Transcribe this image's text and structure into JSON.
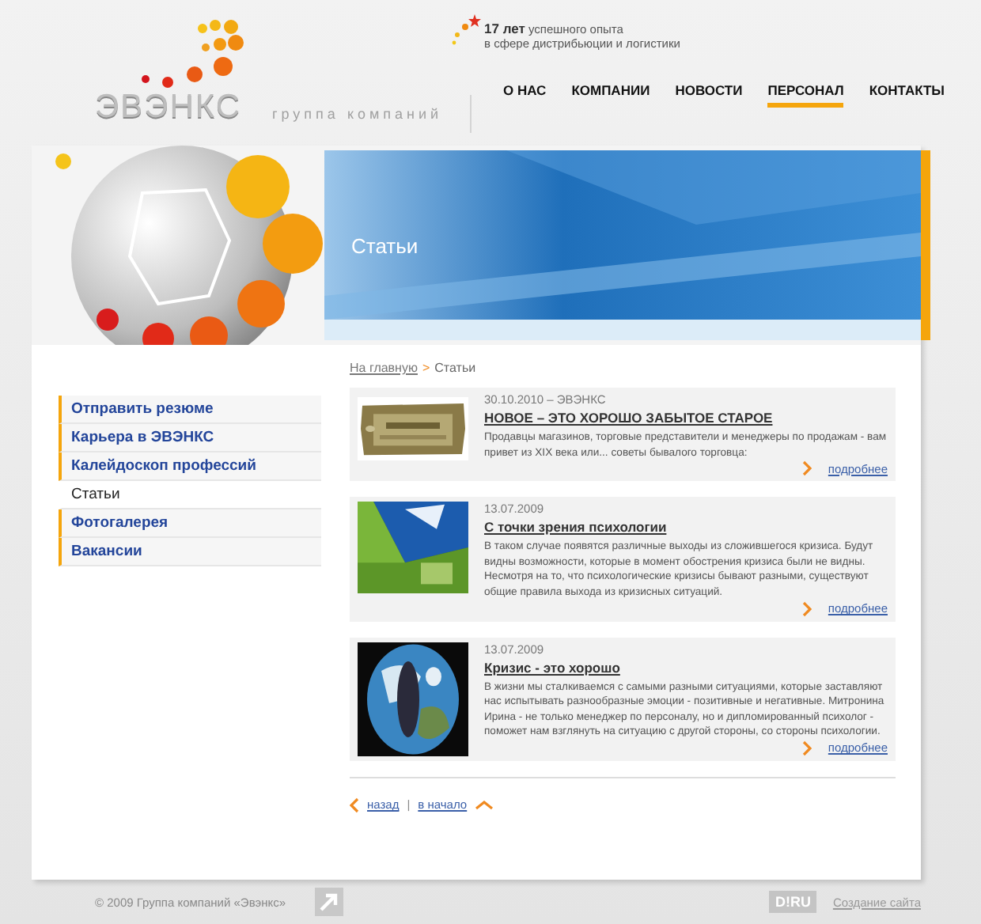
{
  "header": {
    "logo": "ЭВЭНКС",
    "tagline": "группа компаний",
    "experience": "**17 лет** успешного опыта\nв сфере дистрибьюции и логистики"
  },
  "nav": [
    {
      "label": "О НАС",
      "selected": false
    },
    {
      "label": "КОМПАНИИ",
      "selected": false
    },
    {
      "label": "НОВОСТИ",
      "selected": false
    },
    {
      "label": "ПЕРСОНАЛ",
      "selected": true
    },
    {
      "label": "КОНТАКТЫ",
      "selected": false
    }
  ],
  "banner": {
    "title": "Статьи"
  },
  "sidebar": {
    "items": [
      {
        "label": "Отправить резюме",
        "selected": false
      },
      {
        "label": "Карьера в ЭВЭНКС",
        "selected": false
      },
      {
        "label": "Калейдоскоп профессий",
        "selected": false
      },
      {
        "label": "Статьи",
        "selected": true
      },
      {
        "label": "Фотогалерея",
        "selected": false
      },
      {
        "label": "Вакансии",
        "selected": false
      }
    ]
  },
  "breadcrumb": {
    "home": "На главную",
    "separator": ">",
    "current": "Статьи"
  },
  "articles": [
    {
      "date": "30.10.2010 – ЭВЭНКС",
      "title": "НОВОЕ – ЭТО ХОРОШО ЗАБЫТОЕ СТАРОЕ",
      "excerpt": "Продавцы магазинов, торговые представители и менеджеры по продажам - вам привет из XIX века или... советы бывалого торговца:",
      "more": "подробнее"
    },
    {
      "date": "13.07.2009",
      "title": "С точки зрения психологии",
      "excerpt": "В таком случае появятся различные выходы из сложившегося кризиса. Будут видны возможности, которые в момент обострения кризиса были не видны. Несмотря на то, что психологические кризисы бывают разными, существуют общие правила выхода из кризисных ситуаций.",
      "more": "подробнее"
    },
    {
      "date": "13.07.2009",
      "title": "Кризис - это хорошо",
      "excerpt": "В жизни мы сталкиваемся с самыми разными ситуациями, которые заставляют нас испытывать разнообразные эмоции - позитивные и негативные. Митронина Ирина - не только менеджер по персоналу, но и дипломированный психолог - поможет нам взглянуть на ситуацию с другой стороны, со стороны психологии.",
      "more": "подробнее"
    }
  ],
  "pager": {
    "back": "назад",
    "separator": "|",
    "start": "в начало"
  },
  "footer": {
    "copyright": "© 2009 Группа компаний «Эвэнкс»",
    "badge": "D!RU",
    "credit": "Создание сайта"
  }
}
